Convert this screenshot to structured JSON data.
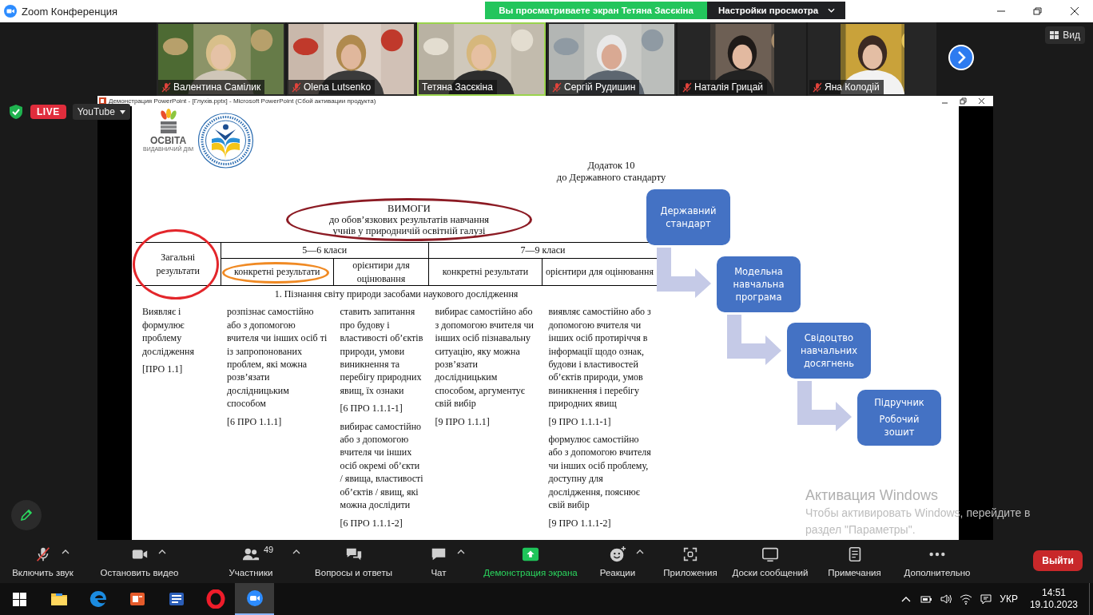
{
  "window": {
    "title": "Zoom Конференция"
  },
  "share_banner": {
    "text": "Вы просматриваете экран Тетяна Засєкіна",
    "settings": "Настройки просмотра"
  },
  "participants": [
    {
      "name": "Валентина Самілик",
      "muted": true,
      "speaking": false
    },
    {
      "name": "Olena Lutsenko",
      "muted": true,
      "speaking": false
    },
    {
      "name": "Тетяна Засєкіна",
      "muted": false,
      "speaking": true
    },
    {
      "name": "Сергій Рудишин",
      "muted": true,
      "speaking": false
    },
    {
      "name": "Наталія Грицай",
      "muted": true,
      "speaking": false
    },
    {
      "name": "Яна Колодій",
      "muted": true,
      "speaking": false
    }
  ],
  "view_button": "Вид",
  "stream": {
    "live": "LIVE",
    "platform": "YouTube"
  },
  "presentation": {
    "window_title": "Демонстрация PowerPoint - [Глухів.pptx] - Microsoft PowerPoint (Сбой активации продукта)",
    "slide": {
      "logo": {
        "name": "ОСВІТА",
        "tagline": "ВИДАВНИЧИЙ ДІМ"
      },
      "appendix": [
        "Додаток 10",
        "до Державного стандарту"
      ],
      "heading": {
        "lines": [
          "ВИМОГИ",
          "до обов’язкових результатів навчання",
          "учнів у природничій освітній галузі"
        ],
        "circled": true
      },
      "table": {
        "general": {
          "text": "Загальні результати",
          "circled": true
        },
        "groups": [
          "5—6 класи",
          "7—9 класи"
        ],
        "subheaders": [
          {
            "text": "конкретні результати",
            "circled": true
          },
          {
            "text": "орієнтири для оцінювання",
            "circled": false
          },
          {
            "text": "конкретні результати",
            "circled": false
          },
          {
            "text": "орієнтири для оцінювання",
            "circled": false
          }
        ],
        "section": "1. Пізнання світу природи засобами наукового дослідження",
        "cells": [
          [
            "Виявляє і формулює проблему дослідження",
            "[ПРО 1.1]"
          ],
          [
            "розпізнає самостійно або з допомогою вчителя чи інших осіб ті із запропонованих проблем, які можна розв’язати дослідницьким способом",
            "[6 ПРО 1.1.1]"
          ],
          [
            "ставить запитання про будову і властивості об’єктів природи, умови виникнення та перебігу природних явищ, їх ознаки",
            "[6 ПРО 1.1.1-1]",
            "вибирає самостійно або з допомогою вчителя чи інших осіб окремі об’єкти / явища, властивості об’єктів / явищ, які можна дослідити",
            "[6 ПРО 1.1.1-2]"
          ],
          [
            "вибирає самостійно або з допомогою вчителя чи інших осіб пізнавальну ситуацію,  яку можна розв’язати дослідницьким способом, аргументує свій вибір",
            "[9 ПРО 1.1.1]"
          ],
          [
            "виявляє самостійно або з допомогою вчителя чи інших осіб протиріччя в інформації щодо ознак, будови і властивостей об’єктів природи, умов виникнення і перебігу природних явищ",
            "[9 ПРО 1.1.1-1]",
            "формулює самостійно або з допомогою вчителя чи інших осіб проблему, доступну для дослідження, пояснює свій вибір",
            "[9 ПРО 1.1.1-2]"
          ]
        ]
      },
      "flow": [
        {
          "lines": [
            "Державний стандарт"
          ]
        },
        {
          "lines": [
            "Модельна навчальна програма"
          ]
        },
        {
          "lines": [
            "Свідоцтво навчальних досягнень"
          ]
        },
        {
          "lines": [
            "Підручник",
            "Робочий зошит"
          ]
        }
      ]
    }
  },
  "activation": {
    "title": "Активация Windows",
    "lines": [
      "Чтобы активировать Windows, перейдите в",
      "раздел \"Параметры\"."
    ]
  },
  "toolbar": [
    {
      "label": "Включить звук",
      "kind": "mic-off",
      "caret": true,
      "active": false
    },
    {
      "label": "Остановить видео",
      "kind": "camera",
      "caret": true,
      "active": false
    },
    {
      "label": "Участники",
      "kind": "people",
      "caret": true,
      "active": false,
      "count": "49"
    },
    {
      "label": "Вопросы и ответы",
      "kind": "qa",
      "caret": false,
      "active": false
    },
    {
      "label": "Чат",
      "kind": "chat",
      "caret": true,
      "active": false
    },
    {
      "label": "Демонстрация экрана",
      "kind": "share",
      "caret": false,
      "active": true
    },
    {
      "label": "Реакции",
      "kind": "reactions",
      "caret": true,
      "active": false
    },
    {
      "label": "Приложения",
      "kind": "apps",
      "caret": false,
      "active": false
    },
    {
      "label": "Доски сообщений",
      "kind": "board",
      "caret": false,
      "active": false
    },
    {
      "label": "Примечания",
      "kind": "notes",
      "caret": false,
      "active": false
    },
    {
      "label": "Дополнительно",
      "kind": "more",
      "caret": false,
      "active": false
    }
  ],
  "leave": "Выйти",
  "taskbar": {
    "apps": [
      {
        "kind": "explorer",
        "active": false
      },
      {
        "kind": "edge",
        "active": false
      },
      {
        "kind": "powerpoint",
        "active": false
      },
      {
        "kind": "word",
        "active": false
      },
      {
        "kind": "opera",
        "active": false
      },
      {
        "kind": "zoom",
        "active": true
      }
    ]
  },
  "tray": {
    "language": "УКР",
    "time": "14:51",
    "date": "19.10.2023"
  }
}
